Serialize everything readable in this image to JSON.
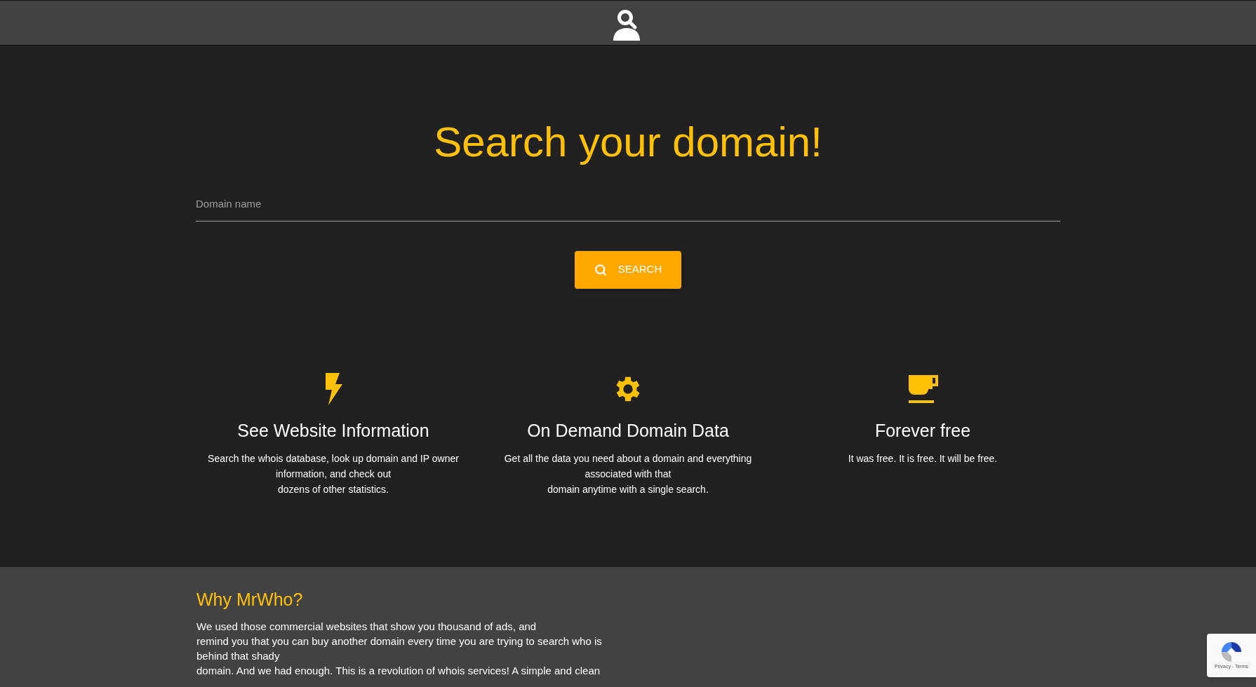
{
  "hero": {
    "title": "Search your domain!",
    "search": {
      "placeholder": "Domain name"
    },
    "button": "SEARCH"
  },
  "features": [
    {
      "kind": "bolt",
      "title": "See Website Information",
      "lines": [
        "Search the whois database, look up domain and IP owner information, and check out",
        "dozens of other statistics."
      ]
    },
    {
      "kind": "gear",
      "title": "On Demand Domain Data",
      "lines": [
        "Get all the data you need about a domain and everything associated with that",
        "domain anytime with a single search."
      ]
    },
    {
      "kind": "cup",
      "title": "Forever free",
      "lines": [
        "It was free. It is free. It will be free."
      ]
    }
  ],
  "about": {
    "title": "Why MrWho?",
    "lines": [
      "We used those commercial websites that show you thousand of ads, and",
      "remind you that you can buy another domain every time you are trying to search who is behind that shady",
      "domain. And we had enough. This is a revolution of whois services! A simple and clean"
    ]
  },
  "recaptcha": {
    "links": "Privacy - Terms"
  }
}
